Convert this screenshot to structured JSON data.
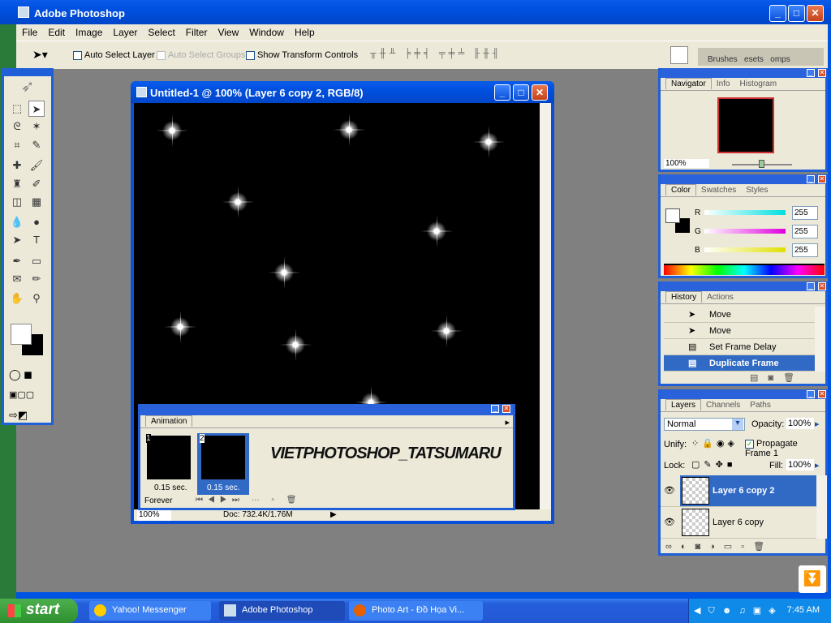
{
  "app": {
    "title": "Adobe Photoshop"
  },
  "menu": [
    "File",
    "Edit",
    "Image",
    "Layer",
    "Select",
    "Filter",
    "View",
    "Window",
    "Help"
  ],
  "options": {
    "auto_select_layer": "Auto Select Layer",
    "auto_select_groups": "Auto Select Groups",
    "show_transform": "Show Transform Controls",
    "well_tabs": [
      "Brushes",
      "esets",
      "omps"
    ]
  },
  "document": {
    "title": "Untitled-1 @ 100% (Layer 6 copy 2, RGB/8)",
    "zoom": "100%",
    "doc_size": "Doc: 732.4K/1.76M"
  },
  "animation": {
    "tab": "Animation",
    "frames": [
      {
        "num": "1",
        "delay": "0.15 sec."
      },
      {
        "num": "2",
        "delay": "0.15 sec."
      }
    ],
    "loop": "Forever",
    "watermark": "VIETPHOTOSHOP_TATSUMARU"
  },
  "navigator": {
    "tabs": [
      "Navigator",
      "Info",
      "Histogram"
    ],
    "zoom": "100%"
  },
  "color": {
    "tabs": [
      "Color",
      "Swatches",
      "Styles"
    ],
    "channels": [
      {
        "label": "R",
        "value": "255",
        "color": "#00e0e0"
      },
      {
        "label": "G",
        "value": "255",
        "color": "#e000e0"
      },
      {
        "label": "B",
        "value": "255",
        "color": "#e0e000"
      }
    ]
  },
  "history": {
    "tabs": [
      "History",
      "Actions"
    ],
    "items": [
      "Move",
      "Move",
      "Set Frame Delay",
      "Duplicate Frame"
    ],
    "selected": 3
  },
  "layers": {
    "tabs": [
      "Layers",
      "Channels",
      "Paths"
    ],
    "blend": "Normal",
    "opacity_label": "Opacity:",
    "opacity": "100%",
    "unify_label": "Unify:",
    "propagate": "Propagate Frame 1",
    "lock_label": "Lock:",
    "fill_label": "Fill:",
    "fill": "100%",
    "items": [
      "Layer 6 copy 2",
      "Layer 6 copy"
    ],
    "selected": 0
  },
  "taskbar": {
    "start": "start",
    "items": [
      "Yahoo! Messenger",
      "Adobe Photoshop",
      "Photo Art - Đồ Họa Vi..."
    ],
    "clock": "7:45 AM"
  },
  "colors": {
    "xp_blue": "#0054e3",
    "selection": "#316ac5",
    "panel": "#ece9d8",
    "workspace": "#808080"
  }
}
